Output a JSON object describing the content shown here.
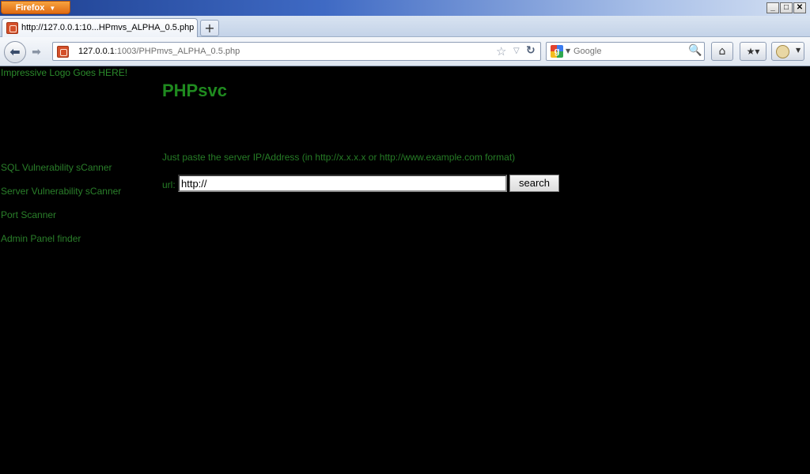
{
  "browser": {
    "menu_button": "Firefox",
    "window_controls": {
      "minimize": "_",
      "maximize": "□",
      "close": "✕"
    },
    "tab": {
      "title": "http://127.0.0.1:10...HPmvs_ALPHA_0.5.php",
      "favicon": "xampp-icon"
    },
    "new_tab_label": "+",
    "address": {
      "host": "127.0.0.1",
      "rest": ":1003/PHPmvs_ALPHA_0.5.php"
    },
    "search": {
      "engine": "Google",
      "placeholder": "Google"
    }
  },
  "page": {
    "logo_text": "Impressive Logo Goes HERE!",
    "title": "PHPsvc",
    "nav": [
      {
        "label": "SQL Vulnerability sCanner"
      },
      {
        "label": "Server Vulnerability sCanner"
      },
      {
        "label": "Port Scanner"
      },
      {
        "label": "Admin Panel finder"
      }
    ],
    "instruction": "Just paste the server IP/Address (in http://x.x.x.x or http://www.example.com format)",
    "url_label": "url:",
    "url_value": "http://",
    "search_button": "search"
  },
  "colors": {
    "page_bg": "#000000",
    "text_green": "#1f8a1f"
  }
}
